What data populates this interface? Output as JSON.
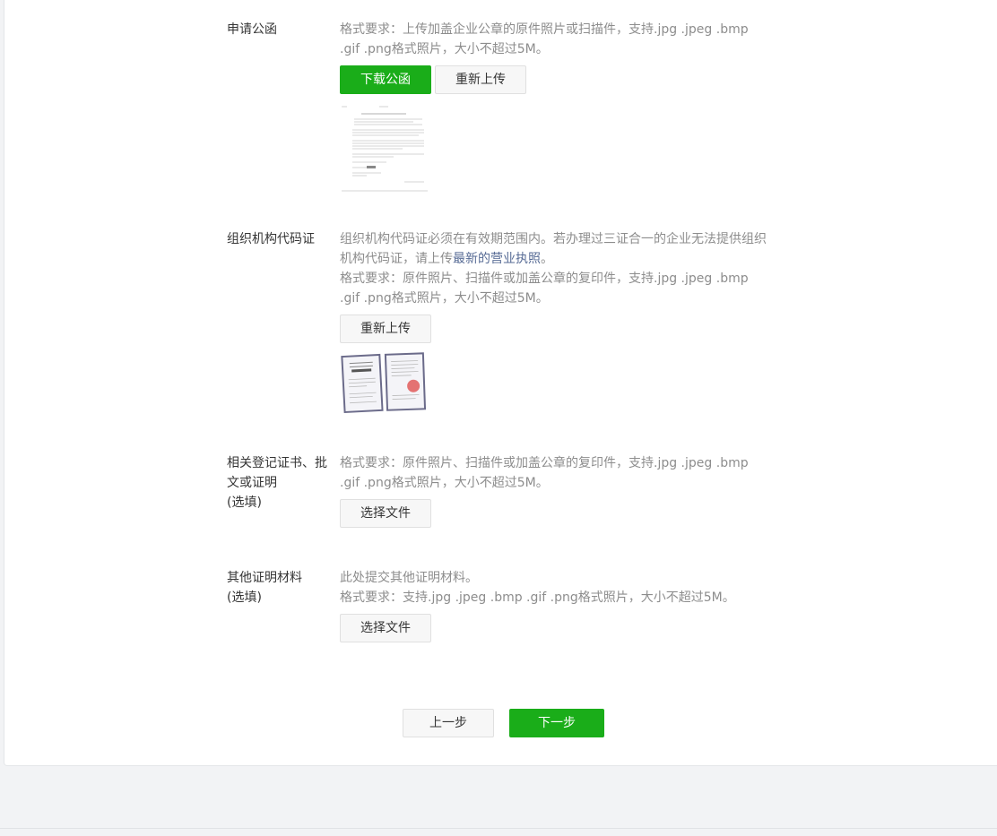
{
  "sections": {
    "letter": {
      "label": "申请公函",
      "desc": "格式要求：上传加盖企业公章的原件照片或扫描件，支持.jpg .jpeg .bmp .gif .png格式照片，大小不超过5M。",
      "download_btn": "下载公函",
      "reupload_btn": "重新上传"
    },
    "org_code": {
      "label": "组织机构代码证",
      "desc_prefix": "组织机构代码证必须在有效期范围内。若办理过三证合一的企业无法提供组织机构代码证，请上传",
      "desc_link": "最新的营业执照",
      "desc_suffix": "。",
      "format": "格式要求：原件照片、扫描件或加盖公章的复印件，支持.jpg .jpeg .bmp .gif .png格式照片，大小不超过5M。",
      "reupload_btn": "重新上传"
    },
    "related_cert": {
      "label": "相关登记证书、批文或证明",
      "optional": "(选填)",
      "desc": "格式要求：原件照片、扫描件或加盖公章的复印件，支持.jpg .jpeg .bmp .gif .png格式照片，大小不超过5M。",
      "choose_btn": "选择文件"
    },
    "other": {
      "label": "其他证明材料",
      "optional": "(选填)",
      "desc": "此处提交其他证明材料。",
      "format": "格式要求：支持.jpg .jpeg .bmp .gif .png格式照片，大小不超过5M。",
      "choose_btn": "选择文件"
    }
  },
  "nav": {
    "prev": "上一步",
    "next": "下一步"
  },
  "colors": {
    "primary": "#1aad19",
    "link": "#576b95",
    "muted": "#8d8d8d"
  }
}
